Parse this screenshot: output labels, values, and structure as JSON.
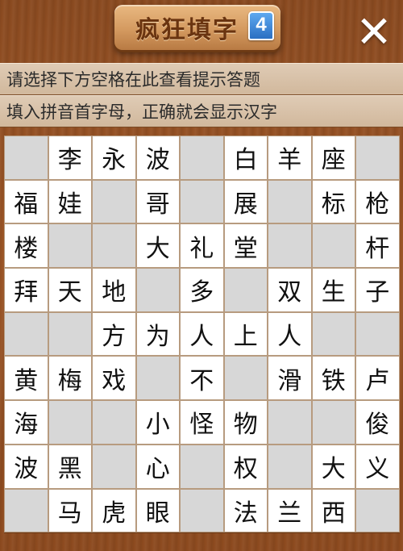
{
  "header": {
    "title": "疯狂填字",
    "level": "4",
    "close_label": "✕"
  },
  "hints": {
    "line1": "请选择下方空格在此查看提示答题",
    "line2": "填入拼音首字母，正确就会显示汉字"
  },
  "grid": [
    [
      "",
      "李",
      "永",
      "波",
      "",
      "白",
      "羊",
      "座",
      ""
    ],
    [
      "福",
      "娃",
      "",
      "哥",
      "",
      "展",
      "",
      "标",
      "枪"
    ],
    [
      "楼",
      "",
      "",
      "大",
      "礼",
      "堂",
      "",
      "",
      "杆"
    ],
    [
      "拜",
      "天",
      "地",
      "",
      "多",
      "",
      "双",
      "生",
      "子"
    ],
    [
      "",
      "",
      "方",
      "为",
      "人",
      "上",
      "人",
      "",
      ""
    ],
    [
      "黄",
      "梅",
      "戏",
      "",
      "不",
      "",
      "滑",
      "铁",
      "卢"
    ],
    [
      "海",
      "",
      "",
      "小",
      "怪",
      "物",
      "",
      "",
      "俊"
    ],
    [
      "波",
      "黑",
      "",
      "心",
      "",
      "权",
      "",
      "大",
      "义"
    ],
    [
      "",
      "马",
      "虎",
      "眼",
      "",
      "法",
      "兰",
      "西",
      ""
    ]
  ],
  "colors": {
    "cell_white": "#ffffff",
    "cell_gray": "#d7d7d7",
    "wood": "#9b5526"
  }
}
